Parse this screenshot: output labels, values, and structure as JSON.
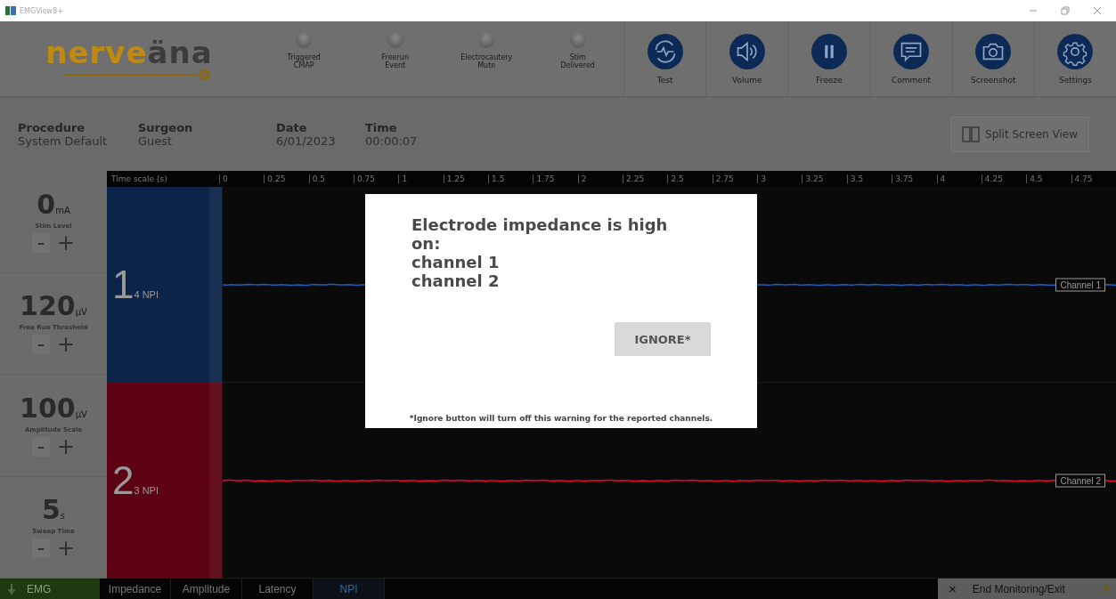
{
  "window": {
    "title": "EMGView8+"
  },
  "logo": {
    "first": "nerve",
    "second": "äna"
  },
  "indicators": [
    {
      "lines": [
        "Triggered",
        "CMAP"
      ],
      "on": false
    },
    {
      "lines": [
        "Freerun",
        "Event"
      ],
      "on": false
    },
    {
      "lines": [
        "Electrocautery",
        "Mute"
      ],
      "on": false
    },
    {
      "lines": [
        "Stim",
        "Delivered"
      ],
      "on": false
    }
  ],
  "toolbar": [
    {
      "label": "Test",
      "kind": "test"
    },
    {
      "label": "Volume",
      "kind": "volume"
    },
    {
      "label": "Freeze",
      "kind": "pause"
    },
    {
      "label": "Comment",
      "kind": "comment"
    },
    {
      "label": "Screenshot",
      "kind": "camera"
    },
    {
      "label": "Settings",
      "kind": "gear"
    }
  ],
  "info": [
    {
      "label": "Procedure",
      "value": "System Default"
    },
    {
      "label": "Surgeon",
      "value": "Guest"
    },
    {
      "label": "Date",
      "value": "6/01/2023"
    },
    {
      "label": "Time",
      "value": "00:00:07"
    }
  ],
  "split_button": "Split Screen View",
  "controls": [
    {
      "value": "0",
      "unit": "mA",
      "label": "Stim Level",
      "minus": "-",
      "plus": "+"
    },
    {
      "value": "120",
      "unit": "μV",
      "label": "Free Run Threshold",
      "minus": "-",
      "plus": "+"
    },
    {
      "value": "100",
      "unit": "μV",
      "label": "Amplitude Scale",
      "minus": "-",
      "plus": "+"
    },
    {
      "value": "5",
      "unit": "s",
      "label": "Sweep Time",
      "minus": "-",
      "plus": "+"
    }
  ],
  "time_scale": {
    "label": "Time scale (s)",
    "ticks": [
      "0",
      "0.25",
      "0.5",
      "0.75",
      "1",
      "1.25",
      "1.5",
      "1.75",
      "2",
      "2.25",
      "2.5",
      "2.75",
      "3",
      "3.25",
      "3.5",
      "3.75",
      "4",
      "4.25",
      "4.5",
      "4.75"
    ]
  },
  "channels": [
    {
      "number": "1",
      "npi": "4 NPI",
      "color": "#0b2448",
      "name": "Channel 1"
    },
    {
      "number": "2",
      "npi": "3 NPI",
      "color": "#5c0212",
      "name": "Channel 2"
    }
  ],
  "dialog": {
    "message": "Electrode impedance is high on:",
    "lines": [
      "channel 1",
      "channel 2"
    ],
    "button": "IGNORE*",
    "footnote": "*Ignore button will turn off this warning for the reported channels."
  },
  "mode_tab": {
    "label": "EMG"
  },
  "tabs": [
    {
      "label": "Impedance",
      "selected": false
    },
    {
      "label": "Amplitude",
      "selected": false
    },
    {
      "label": "Latency",
      "selected": false
    },
    {
      "label": "NPI",
      "selected": true
    }
  ],
  "exit_button": {
    "icon": "×",
    "label": "End Monitoring/Exit"
  }
}
